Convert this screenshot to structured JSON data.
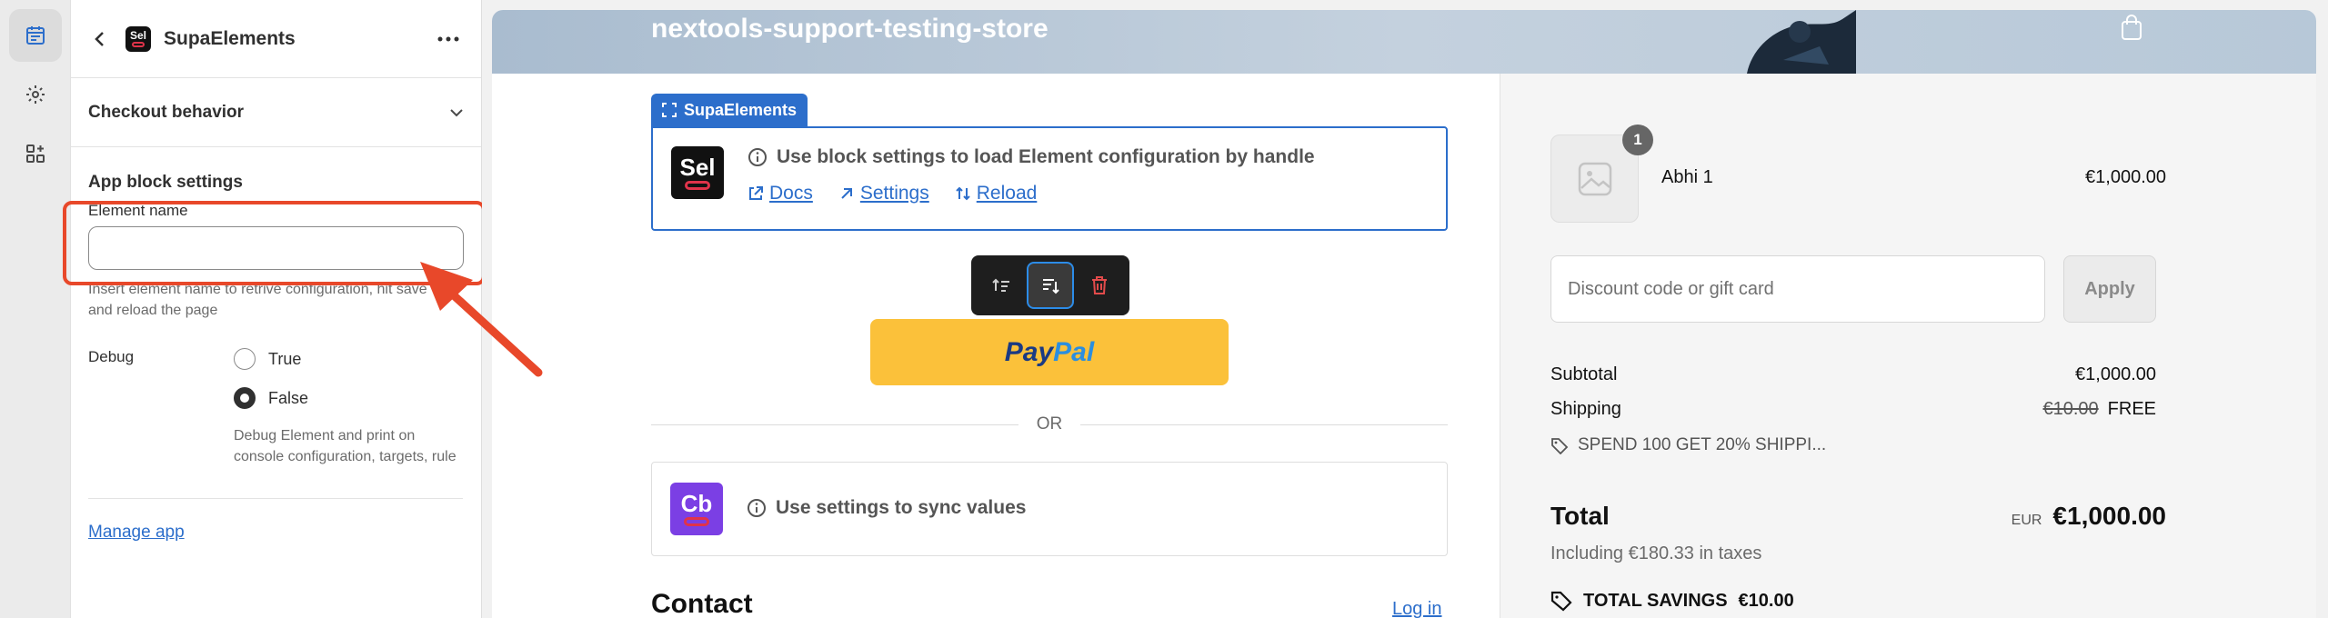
{
  "panel": {
    "title": "SupaElements",
    "logo_text": "Sel",
    "section_checkout": "Checkout behavior",
    "block_title": "App block settings",
    "element_name_label": "Element name",
    "element_name_value": "",
    "element_name_help": "Insert element name to retrive configuration, hit save and reload the page",
    "debug_label": "Debug",
    "debug_options": [
      "True",
      "False"
    ],
    "debug_selected": "False",
    "debug_help": "Debug Element and print on console configuration, targets, rule",
    "manage_app": "Manage app"
  },
  "store": {
    "name": "nextools-support-testing-store"
  },
  "supa": {
    "tag": "SupaElements",
    "logo_text": "Sel",
    "info": "Use block settings to load Element configuration by handle",
    "links": [
      "Docs",
      "Settings",
      "Reload"
    ]
  },
  "paypal": {
    "part1": "Pay",
    "part2": "Pal"
  },
  "or_text": "OR",
  "cb": {
    "logo_text": "Cb",
    "info": "Use settings to sync values"
  },
  "contact": {
    "title": "Contact",
    "login": "Log in"
  },
  "summary": {
    "item": {
      "name": "Abhi 1",
      "price": "€1,000.00",
      "qty": "1"
    },
    "discount_placeholder": "Discount code or gift card",
    "apply": "Apply",
    "subtotal_label": "Subtotal",
    "subtotal_value": "€1,000.00",
    "shipping_label": "Shipping",
    "shipping_old": "€10.00",
    "shipping_value": "FREE",
    "promo": "SPEND 100 GET 20% SHIPPI...",
    "total_label": "Total",
    "currency": "EUR",
    "total_value": "€1,000.00",
    "taxes": "Including €180.33 in taxes",
    "savings_label": "TOTAL SAVINGS",
    "savings_value": "€10.00"
  },
  "colors": {
    "accent": "#2c6ecb",
    "highlight": "#e8482a",
    "paypal": "#fbc13a"
  }
}
